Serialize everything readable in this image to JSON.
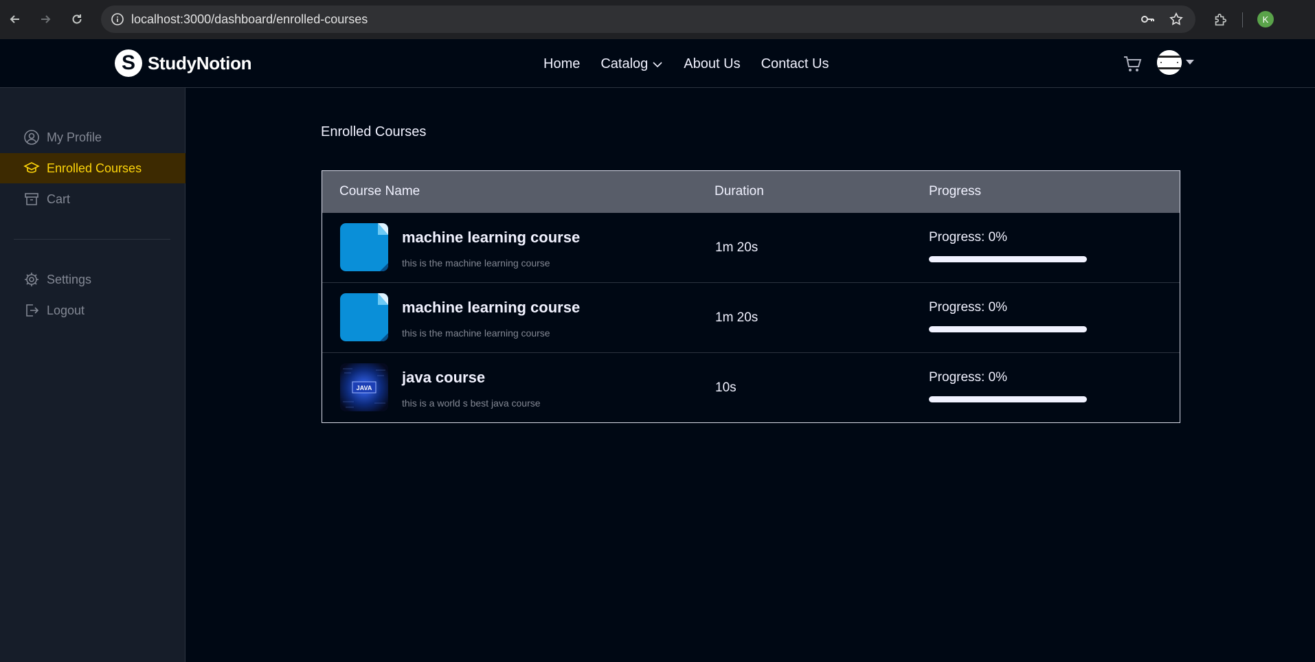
{
  "browser": {
    "url": "localhost:3000/dashboard/enrolled-courses",
    "profile_initial": "K"
  },
  "navbar": {
    "brand": "StudyNotion",
    "brand_letter": "S",
    "links": [
      {
        "label": "Home"
      },
      {
        "label": "Catalog",
        "has_dropdown": true
      },
      {
        "label": "About Us"
      },
      {
        "label": "Contact Us"
      }
    ]
  },
  "sidebar": {
    "items": [
      {
        "label": "My Profile",
        "icon": "user-circle-icon",
        "active": false
      },
      {
        "label": "Enrolled Courses",
        "icon": "graduation-cap-icon",
        "active": true
      },
      {
        "label": "Cart",
        "icon": "archive-box-icon",
        "active": false
      }
    ],
    "bottom_items": [
      {
        "label": "Settings",
        "icon": "gear-icon"
      },
      {
        "label": "Logout",
        "icon": "logout-icon"
      }
    ]
  },
  "main": {
    "title": "Enrolled Courses",
    "table": {
      "headers": [
        "Course Name",
        "Duration",
        "Progress"
      ],
      "rows": [
        {
          "name": "machine learning course",
          "description": "this is the machine learning course",
          "duration": "1m 20s",
          "progress_label": "Progress: 0%",
          "progress": 0,
          "thumb": "file-icon"
        },
        {
          "name": "machine learning course",
          "description": "this is the machine learning course",
          "duration": "1m 20s",
          "progress_label": "Progress: 0%",
          "progress": 0,
          "thumb": "file-icon"
        },
        {
          "name": "java course",
          "description": "this is a world s best java course",
          "duration": "10s",
          "progress_label": "Progress: 0%",
          "progress": 0,
          "thumb": "java-image",
          "thumb_text": "JAVA"
        }
      ]
    }
  },
  "colors": {
    "active_text": "#ffd60a",
    "active_bg": "#3d2a01",
    "table_header_bg": "#585d69"
  }
}
